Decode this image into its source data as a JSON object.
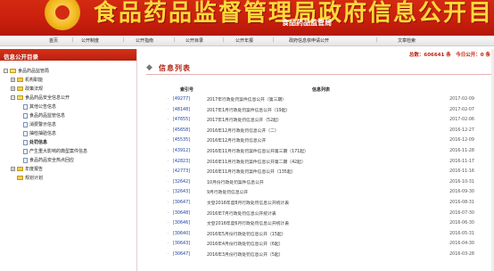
{
  "banner": {
    "title": "食品药品监督管理局政府信息公开目录",
    "subtitle": "食品药品监管局"
  },
  "topnav": {
    "items": [
      "首页",
      "公开制度",
      "公开指南",
      "公开目录",
      "公开年报",
      "政府信息依申请公开",
      "文章检索"
    ]
  },
  "sidebar": {
    "title": "信息公开目录",
    "items": [
      "食品药品监管局",
      "机构职能",
      "政策法规",
      "食品药品安全信息公开",
      "其他公告信息",
      "食品药品监管信息",
      "消费警示信息",
      "抽检抽验信息",
      "处罚信息",
      "产生重大影响的典型案件信息",
      "食品药品安全热点回应",
      "年度报告",
      "规划计划"
    ]
  },
  "main": {
    "stats": "总数：606641 条　今日公开：0 条",
    "list_title": "信息列表",
    "col_id": "索引号",
    "col_title": "信息列表",
    "rows": [
      {
        "id": "[49277]",
        "title": "2017年行政处罚案件信息公开（第三期）",
        "date": "2017-02-09"
      },
      {
        "id": "[48148]",
        "title": "2017年1月行政处罚案件信息公开（19起）",
        "date": "2017-02-07"
      },
      {
        "id": "[47655]",
        "title": "2017年1月行政处罚信息公开（52起）",
        "date": "2017-02-06"
      },
      {
        "id": "[45658]",
        "title": "2016年12月行政处罚信息公开（二）",
        "date": "2016-12-27"
      },
      {
        "id": "[45535]",
        "title": "2016年12月行政处罚信息公开",
        "date": "2016-12-09"
      },
      {
        "id": "[43912]",
        "title": "2016年11月行政处罚案件信息公开第三期（171起）",
        "date": "2016-11-28"
      },
      {
        "id": "[42823]",
        "title": "2016年11月行政处罚案件信息公开第二期（42起）",
        "date": "2016-11-17"
      },
      {
        "id": "[42773]",
        "title": "2016年11月行政处罚案件信息公开（135起）",
        "date": "2016-11-16"
      },
      {
        "id": "[32642]",
        "title": "10月份行政处罚案件信息公开",
        "date": "2016-10-31"
      },
      {
        "id": "[32643]",
        "title": "9月行政处罚信息公开",
        "date": "2016-09-30"
      },
      {
        "id": "[30647]",
        "title": "文登2016年度8月行政处罚信息公开统计表",
        "date": "2016-08-31"
      },
      {
        "id": "[30648]",
        "title": "2016年7月行政处罚信息公开统计表",
        "date": "2016-07-30"
      },
      {
        "id": "[30646]",
        "title": "文登2016年度6月行政处罚信息公开统计表",
        "date": "2016-06-30"
      },
      {
        "id": "[30640]",
        "title": "2016年5月份行政处罚信息公开（15起）",
        "date": "2016-05-31"
      },
      {
        "id": "[30643]",
        "title": "2016年4月份行政处罚信息公开（6起）",
        "date": "2016-04-30"
      },
      {
        "id": "[30647]",
        "title": "2016年3月份行政处罚信息公开（5起）",
        "date": "2016-03-28"
      }
    ]
  }
}
